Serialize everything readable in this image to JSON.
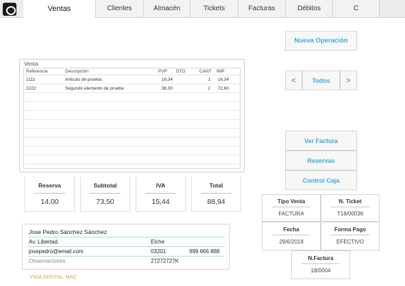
{
  "tabs": [
    {
      "label": "Ventas",
      "active": true
    },
    {
      "label": "Clientes",
      "active": false
    },
    {
      "label": "Almacén",
      "active": false
    },
    {
      "label": "Tickets",
      "active": false
    },
    {
      "label": "Facturas",
      "active": false
    },
    {
      "label": "Débitos",
      "active": false
    },
    {
      "label": "C",
      "active": false
    }
  ],
  "venta": {
    "title": "Venta",
    "headers": {
      "ref": "Referencia",
      "desc": "Descripción",
      "pvp": "PVP",
      "dto": "DTO",
      "cant": "CANT",
      "imp": "IMP"
    },
    "rows": [
      {
        "ref": "1111",
        "desc": "Artículo de prueba",
        "pvp": "16,34",
        "dto": "",
        "cant": "1",
        "imp": "16,34"
      },
      {
        "ref": "2222",
        "desc": "Segundo elemento de prueba",
        "pvp": "36,30",
        "dto": "",
        "cant": "2",
        "imp": "72,60"
      }
    ]
  },
  "totals": {
    "reserva": {
      "label": "Reserva",
      "value": "14,00"
    },
    "subtotal": {
      "label": "Subtotal",
      "value": "73,50"
    },
    "iva": {
      "label": "IVA",
      "value": "15,44"
    },
    "total": {
      "label": "Total",
      "value": "88,94"
    }
  },
  "customer": {
    "name": "Jose Pedro Sánchez Sánchez",
    "address": "Av. Libertad.",
    "city": "Elche",
    "email": "josepedro@email.com",
    "postal_code": "03201",
    "phone": "999 666 888",
    "notes_label": "Observaciones",
    "tax_id": "27272727K"
  },
  "brand": "VIDA DIGITAL MAC",
  "actions": {
    "new_operation": "Nueva Operación",
    "prev": "<",
    "filter": "Todos",
    "next": ">",
    "ver_factura": "Ver Factura",
    "reservas": "Reservas",
    "control_caja": "Control Caja"
  },
  "ticket_info": {
    "tipo_venta_label": "Tipo Venta",
    "tipo_venta": "FACTURA",
    "n_ticket_label": "N. Ticket",
    "n_ticket": "T18/00036",
    "fecha_label": "Fecha",
    "fecha": "29/6/2018",
    "forma_pago_label": "Forma Pago",
    "forma_pago": "EFECTIVO",
    "n_factura_label": "N.Factura",
    "n_factura": "18/0004"
  },
  "colors": {
    "accent": "#3aa9e0",
    "brand": "#e8932a",
    "divider": "#a8ddd6"
  }
}
